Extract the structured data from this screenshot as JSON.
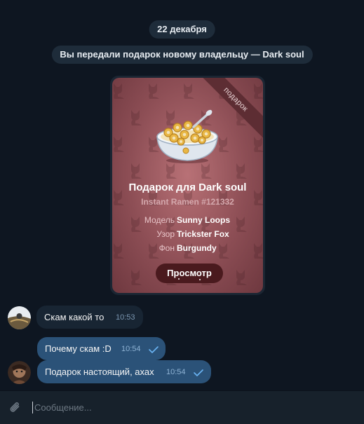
{
  "chat": {
    "date_label": "22 декабря",
    "service_message": "Вы передали подарок новому владельцу — Dark soul"
  },
  "gift": {
    "ribbon_label": "подарок",
    "title": "Подарок для Dark soul",
    "subtitle": "Instant Ramen #121332",
    "attributes": [
      {
        "key": "Модель",
        "value": "Sunny Loops"
      },
      {
        "key": "Узор",
        "value": "Trickster Fox"
      },
      {
        "key": "Фон",
        "value": "Burgundy"
      }
    ],
    "view_button_label": "Просмотр",
    "background_color": "#8d4e55",
    "pattern_icon": "fox-icon",
    "image_icon": "cereal-bowl-icon"
  },
  "messages": [
    {
      "direction": "incoming",
      "text": "Скам какой то",
      "time": "10:53"
    },
    {
      "direction": "outgoing",
      "text": "Почему скам :D",
      "time": "10:54",
      "status_icon": "check-icon"
    },
    {
      "direction": "outgoing",
      "text": "Подарок настоящий, ахах",
      "time": "10:54",
      "status_icon": "check-icon"
    }
  ],
  "composer": {
    "placeholder": "Сообщение...",
    "attach_icon": "paperclip-icon"
  },
  "colors": {
    "background": "#0e1621",
    "incoming_bubble": "#182533",
    "outgoing_bubble": "#2b5278",
    "accent": "#6ab3f3"
  }
}
